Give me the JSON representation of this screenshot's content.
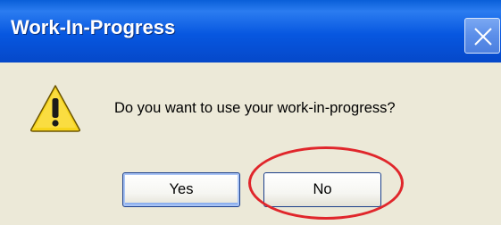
{
  "window": {
    "title": "Work-In-Progress",
    "close_icon": "close-icon"
  },
  "dialog": {
    "icon": "warning-icon",
    "message": "Do you want to use your work-in-progress?",
    "buttons": {
      "yes_label": "Yes",
      "no_label": "No"
    }
  },
  "annotation": {
    "highlight_target": "No",
    "highlight_color": "#e0262b"
  },
  "colors": {
    "titlebar": "#0757e0",
    "dialog_background": "#ece9d8",
    "warning_yellow": "#f7d51d"
  }
}
